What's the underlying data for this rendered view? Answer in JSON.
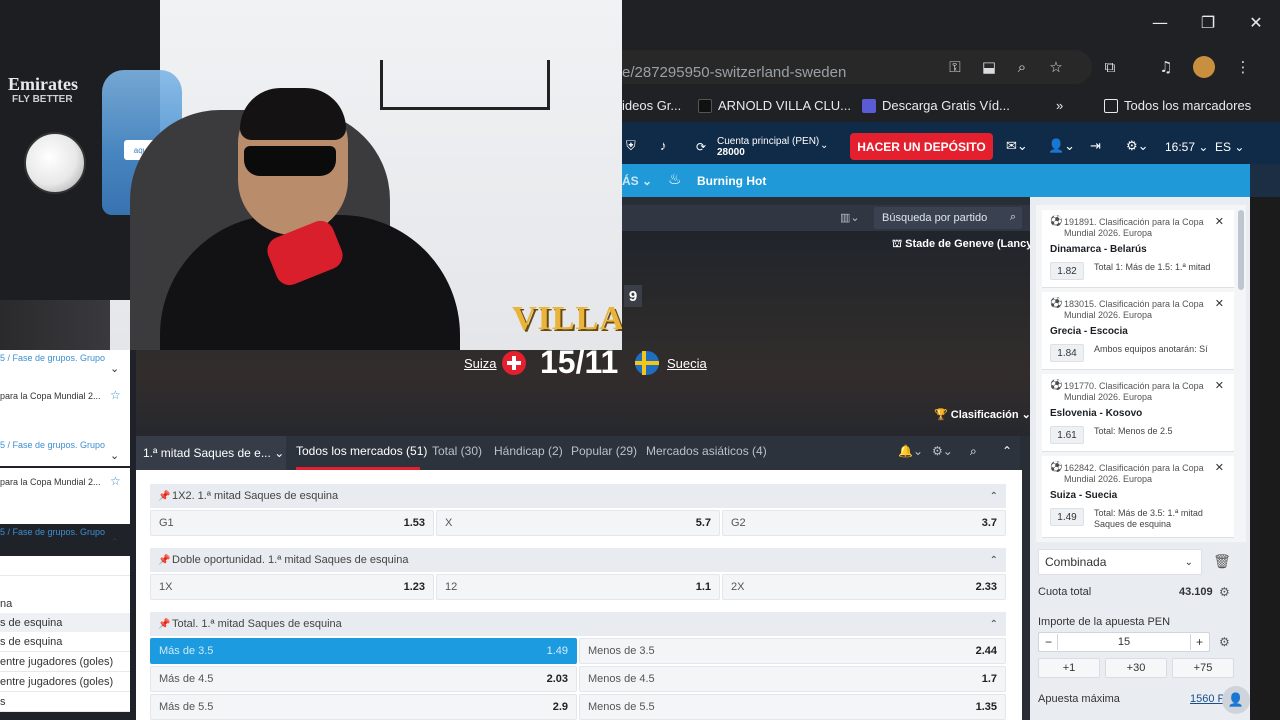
{
  "browser": {
    "window_controls": {
      "minimize": "—",
      "maximize": "❐",
      "close": "✕"
    },
    "address": "e/287295950-switzerland-sweden",
    "bookmarks": [
      {
        "label": "ideos Gr..."
      },
      {
        "label": "ARNOLD VILLA CLU..."
      },
      {
        "label": "Descarga Gratis Víd..."
      },
      {
        "label": "»"
      },
      {
        "label": "Todos los marcadores"
      }
    ]
  },
  "header": {
    "account_label": "Cuenta principal  (PEN)",
    "account_balance": "28000",
    "deposit_label": "HACER UN DEPÓSITO",
    "time": "16:57",
    "language": "ES"
  },
  "nav": {
    "mas_label": "ÁS",
    "burning_hot": "Burning Hot"
  },
  "event": {
    "search_placeholder": "Búsqueda por partido",
    "stadium": "Stade de Geneve (Lancy)",
    "team_home": "Suiza",
    "team_away": "Suecia",
    "score": "15/11",
    "timer_digit": "9",
    "clasificacion_label": "Clasificación",
    "accent_colors": {
      "header": "#0f2b48",
      "nav": "#1f99d8",
      "deposit": "#e4202f"
    }
  },
  "tabs": {
    "first": "1.ª mitad Saques de e...",
    "items": [
      {
        "label": "Todos los mercados (51)"
      },
      {
        "label": "Total (30)"
      },
      {
        "label": "Hándicap (2)"
      },
      {
        "label": "Popular (29)"
      },
      {
        "label": "Mercados asiáticos (4)"
      }
    ]
  },
  "markets": [
    {
      "title": "1X2. 1.ª mitad Saques de esquina",
      "odds": [
        {
          "label": "G1",
          "value": "1.53"
        },
        {
          "label": "X",
          "value": "5.7"
        },
        {
          "label": "G2",
          "value": "3.7"
        }
      ]
    },
    {
      "title": "Doble oportunidad. 1.ª mitad Saques de esquina",
      "odds": [
        {
          "label": "1X",
          "value": "1.23"
        },
        {
          "label": "12",
          "value": "1.1"
        },
        {
          "label": "2X",
          "value": "2.33"
        }
      ]
    },
    {
      "title": "Total. 1.ª mitad Saques de esquina",
      "rows": [
        [
          {
            "label": "Más de 3.5",
            "value": "1.49"
          },
          {
            "label": "Menos de 3.5",
            "value": "2.44"
          }
        ],
        [
          {
            "label": "Más de 4.5",
            "value": "2.03"
          },
          {
            "label": "Menos de 4.5",
            "value": "1.7"
          }
        ],
        [
          {
            "label": "Más de 5.5",
            "value": "2.9"
          },
          {
            "label": "Menos de 5.5",
            "value": "1.35"
          }
        ]
      ]
    }
  ],
  "betslip": {
    "bets": [
      {
        "header": "191891. Clasificación para la Copa Mundial 2026. Europa",
        "teams": "Dinamarca - Belarús",
        "odd": "1.82",
        "selection": "Total 1: Más de 1.5: 1.ª mitad"
      },
      {
        "header": "183015. Clasificación para la Copa Mundial 2026. Europa",
        "teams": "Grecia - Escocia",
        "odd": "1.84",
        "selection": "Ambos equipos anotarán: Sí"
      },
      {
        "header": "191770. Clasificación para la Copa Mundial 2026. Europa",
        "teams": "Eslovenia - Kosovo",
        "odd": "1.61",
        "selection": "Total: Menos de 2.5"
      },
      {
        "header": "162842. Clasificación para la Copa Mundial 2026. Europa",
        "teams": "Suiza - Suecia",
        "odd": "1.49",
        "selection": "Total: Más de 3.5: 1.ª mitad Saques de esquina"
      }
    ],
    "type": "Combinada",
    "total_odds_label": "Cuota total",
    "total_odds": "43.109",
    "stake_label": "Importe de la apuesta PEN",
    "stake": "15",
    "quick": [
      "+1",
      "+30",
      "+75"
    ],
    "max_label": "Apuesta máxima",
    "max_value": "1560 P"
  },
  "left_panel": {
    "links": [
      "5 / Fase de grupos. Grupo",
      "5 / Fase de grupos. Grupo",
      "5 / Fase de grupos. Grupo"
    ],
    "titles": [
      "para la Copa Mundial 2...",
      "para la Copa Mundial 2..."
    ],
    "rows": [
      "na",
      "s de esquina",
      "s de esquina",
      "entre jugadores (goles)",
      "entre jugadores (goles)",
      "s"
    ]
  },
  "cam": {
    "brand_1": "Emirates",
    "brand_2": "FLY BETTER",
    "jug_label": "aquaglo",
    "overlay": "VILLA"
  }
}
